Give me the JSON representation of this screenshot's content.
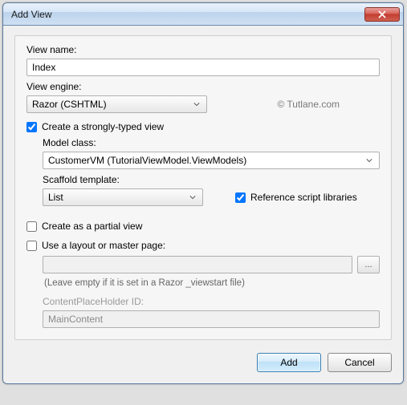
{
  "window": {
    "title": "Add View"
  },
  "viewName": {
    "label": "View name:",
    "value": "Index"
  },
  "viewEngine": {
    "label": "View engine:",
    "selected": "Razor (CSHTML)"
  },
  "watermark": "© Tutlane.com",
  "stronglyTyped": {
    "label": "Create a strongly-typed view",
    "checked": true
  },
  "modelClass": {
    "label": "Model class:",
    "selected": "CustomerVM (TutorialViewModel.ViewModels)"
  },
  "scaffold": {
    "label": "Scaffold template:",
    "selected": "List"
  },
  "refScripts": {
    "label": "Reference script libraries",
    "checked": true
  },
  "partial": {
    "label": "Create as a partial view",
    "checked": false
  },
  "useLayout": {
    "label": "Use a layout or master page:",
    "checked": false,
    "value": "",
    "hint": "(Leave empty if it is set in a Razor _viewstart file)"
  },
  "cph": {
    "label": "ContentPlaceHolder ID:",
    "value": "MainContent"
  },
  "buttons": {
    "add": "Add",
    "cancel": "Cancel",
    "browse": "..."
  }
}
